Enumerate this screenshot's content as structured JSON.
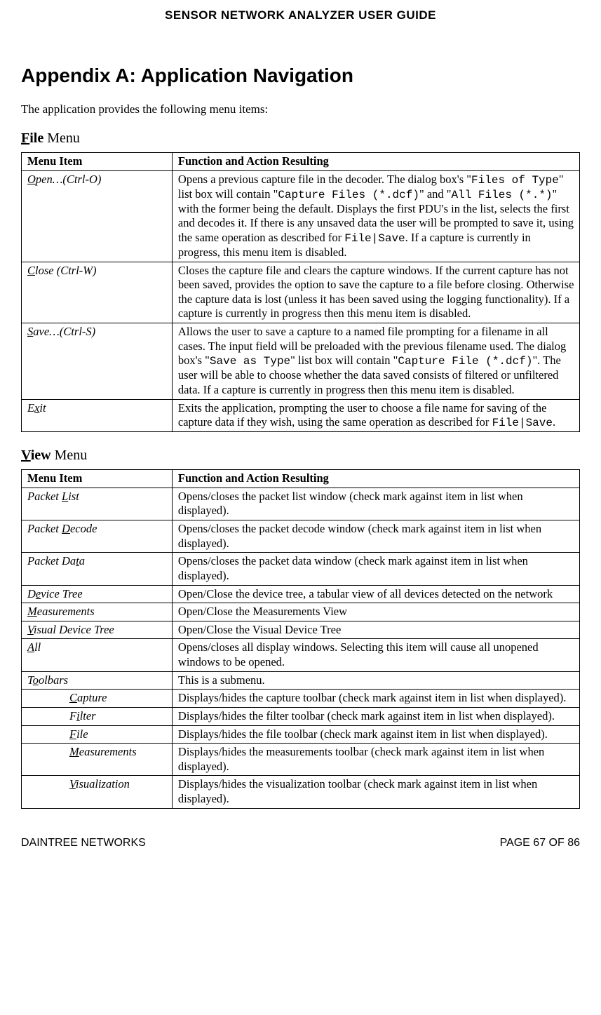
{
  "doc_header": "SENSOR NETWORK ANALYZER USER GUIDE",
  "page_title": "Appendix A: Application Navigation",
  "intro": "The application provides the following menu items:",
  "headers": {
    "col1": "Menu Item",
    "col2": "Function and Action Resulting"
  },
  "file_menu": {
    "label_pre": "F",
    "label_post": "ile",
    "label_suffix": " Menu",
    "rows": [
      {
        "item_html": "<span class='u'>O</span>pen…(Ctrl-O)",
        "desc_html": "Opens a previous capture file in the decoder. The dialog box's \"<span class='mono'>Files of Type</span>\" list box will contain \"<span class='mono'>Capture Files (*.dcf)</span>\" and \"<span class='mono'>All Files (*.*)</span>\" with the former being the default. Displays the first PDU's in the list, selects the first and decodes it. If there is any unsaved data the user will be prompted to save it, using the same operation as described for <span class='mono'>File|Save</span>. If a capture is currently in progress, this menu item is disabled."
      },
      {
        "item_html": "<span class='u'>C</span>lose (Ctrl-W)",
        "desc_html": "Closes the capture file and clears the capture windows.  If the current capture has not been saved, provides the option to save the capture to a file before closing.  Otherwise the capture data is lost (unless it has been saved using the logging functionality). If a capture is currently in progress then this menu item is disabled."
      },
      {
        "item_html": "<span class='u'>S</span>ave…(Ctrl-S)",
        "desc_html": "Allows the user to save a capture to a named file prompting for a filename in all cases. The input field will be preloaded with the previous filename used. The dialog box's \"<span class='mono'>Save as Type</span>\" list box will contain \"<span class='mono'>Capture File (*.dcf)</span>\". The user will be able to choose whether the data saved consists of filtered or unfiltered data. If a capture is currently in progress then this menu item is disabled."
      },
      {
        "item_html": "E<span class='u'>x</span>it",
        "desc_html": "Exits the application, prompting the user to choose a file name for saving of the capture data if they wish, using the same operation as described for <span class='mono'>File|Save</span>."
      }
    ]
  },
  "view_menu": {
    "label_pre": "V",
    "label_post": "iew",
    "label_suffix": " Menu",
    "rows": [
      {
        "item_html": "Packet <span class='u'>L</span>ist",
        "desc_html": "Opens/closes the packet list window (check mark against item in list when displayed)."
      },
      {
        "item_html": "Packet <span class='u'>D</span>ecode",
        "desc_html": "Opens/closes the packet decode window (check mark against item in list when displayed)."
      },
      {
        "item_html": "Packet Da<span class='u'>t</span>a",
        "desc_html": "Opens/closes the packet data window (check mark against item in list when displayed)."
      },
      {
        "item_html": "D<span class='u'>e</span>vice Tree",
        "desc_html": "Open/Close the device tree, a tabular view of all devices detected on the network"
      },
      {
        "item_html": "<span class='u'>M</span>easurements",
        "desc_html": "Open/Close the Measurements View"
      },
      {
        "item_html": "<span class='u'>V</span>isual Device Tree",
        "desc_html": "Open/Close the Visual Device Tree"
      },
      {
        "item_html": "<span class='u'>A</span>ll",
        "desc_html": "Opens/closes all display windows. Selecting this item will cause all unopened windows to be opened."
      },
      {
        "item_html": "T<span class='u'>o</span>olbars",
        "desc_html": "This is a submenu."
      },
      {
        "item_html": "<span class='indent'><span class='u'>C</span>apture</span>",
        "desc_html": "Displays/hides the capture toolbar (check mark against item in list when displayed)."
      },
      {
        "item_html": "<span class='indent'>F<span class='u'>i</span>lter</span>",
        "desc_html": "Displays/hides the filter toolbar (check mark against item in list when displayed)."
      },
      {
        "item_html": "<span class='indent'><span class='u'>F</span>ile</span>",
        "desc_html": "Displays/hides the file toolbar (check mark against item in list when displayed)."
      },
      {
        "item_html": "<span class='indent'><span class='u'>M</span>easurements</span>",
        "desc_html": "Displays/hides the measurements toolbar (check mark against item in list when displayed)."
      },
      {
        "item_html": "<span class='indent'><span class='u'>V</span>isualization</span>",
        "desc_html": "Displays/hides the visualization toolbar (check mark against item in list when displayed)."
      }
    ]
  },
  "footer": {
    "left": "DAINTREE NETWORKS",
    "right": "PAGE 67 OF 86"
  }
}
